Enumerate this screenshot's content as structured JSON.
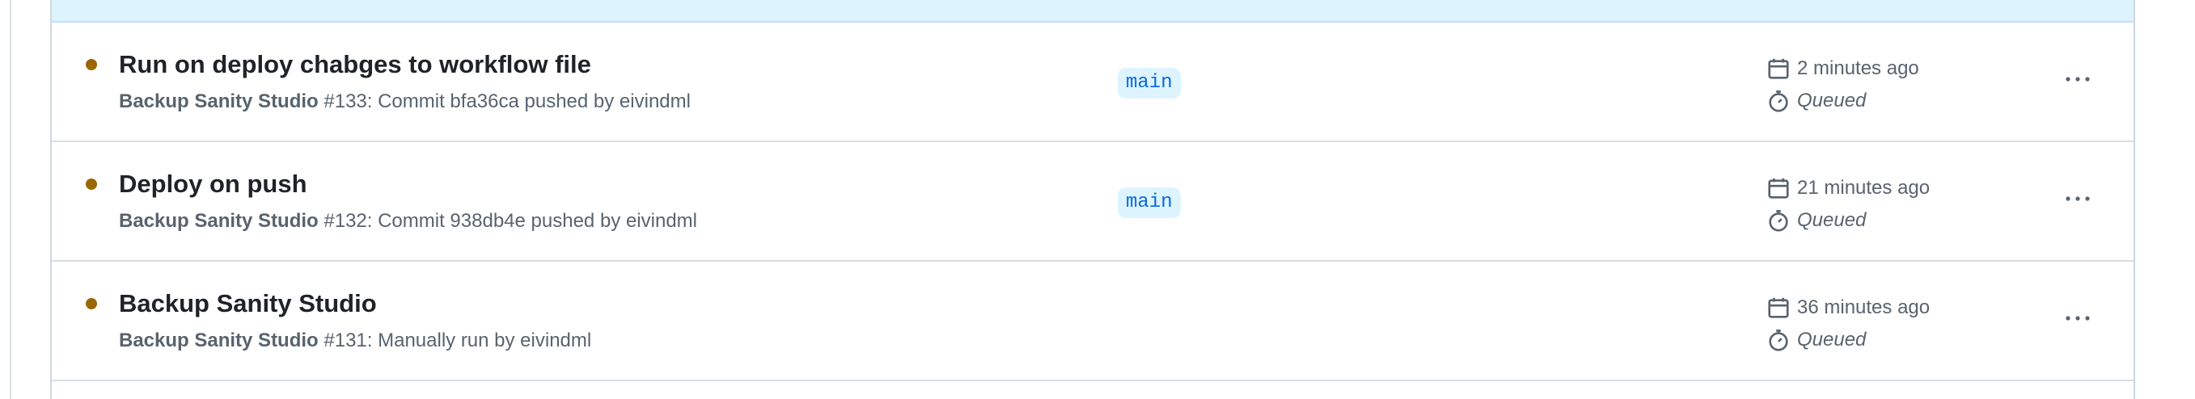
{
  "runs": [
    {
      "title": "Run on deploy chabges to workflow file",
      "workflow": "Backup Sanity Studio",
      "detail": " #133: Commit bfa36ca pushed by eivindml",
      "branch": "main",
      "time": "2 minutes ago",
      "status": "Queued"
    },
    {
      "title": "Deploy on push",
      "workflow": "Backup Sanity Studio",
      "detail": " #132: Commit 938db4e pushed by eivindml",
      "branch": "main",
      "time": "21 minutes ago",
      "status": "Queued"
    },
    {
      "title": "Backup Sanity Studio",
      "workflow": "Backup Sanity Studio",
      "detail": " #131: Manually run by eivindml",
      "branch": "",
      "time": "36 minutes ago",
      "status": "Queued"
    }
  ],
  "colors": {
    "queued_dot": "#9a6700",
    "header_bg": "#ddf4ff",
    "branch_bg": "#ddf4ff",
    "branch_text": "#0969da"
  },
  "icons": {
    "status": "queued-dot-icon",
    "time": "calendar-icon",
    "duration": "stopwatch-icon",
    "menu": "kebab-horizontal-icon"
  }
}
